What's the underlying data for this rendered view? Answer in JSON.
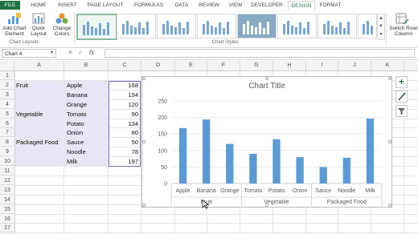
{
  "ribbon": {
    "tabs": [
      "FILE",
      "HOME",
      "INSERT",
      "PAGE LAYOUT",
      "FORMULAS",
      "DATA",
      "REVIEW",
      "VIEW",
      "DEVELOPER",
      "DESIGN",
      "FORMAT"
    ],
    "active_tab": "DESIGN",
    "add_chart_element": "Add Chart Element",
    "quick_layout": "Quick Layout",
    "change_colors": "Change Colors",
    "chart_layouts_group": "Chart Layouts",
    "chart_styles_group": "Chart Styles",
    "switch_row_column": "Switch Row/ Column"
  },
  "formula_bar": {
    "name_box": "Chart 4",
    "fx": "fx"
  },
  "columns": [
    "A",
    "B",
    "C",
    "D",
    "E",
    "F",
    "G",
    "H",
    "I",
    "J",
    "K"
  ],
  "rows": [
    "1",
    "2",
    "3",
    "4",
    "5",
    "6",
    "7",
    "8",
    "9",
    "10",
    "11",
    "12",
    "13",
    "14",
    "15",
    "16",
    "17"
  ],
  "table": [
    {
      "group": "Fruit",
      "item": "Apple",
      "value": "168"
    },
    {
      "group": "",
      "item": "Banana",
      "value": "194"
    },
    {
      "group": "",
      "item": "Orange",
      "value": "120"
    },
    {
      "group": "Vegetable",
      "item": "Tomato",
      "value": "90"
    },
    {
      "group": "",
      "item": "Potato",
      "value": "134"
    },
    {
      "group": "",
      "item": "Onion",
      "value": "80"
    },
    {
      "group": "Packaged Food",
      "item": "Sauce",
      "value": "50"
    },
    {
      "group": "",
      "item": "Noodle",
      "value": "78"
    },
    {
      "group": "",
      "item": "Milk",
      "value": "197"
    }
  ],
  "colors": {
    "bar": "#5b9bd5",
    "excel_green": "#217346",
    "table_fill": "#e8e6f4"
  },
  "chart_data": {
    "type": "bar",
    "title": "Chart Title",
    "categories": [
      "Apple",
      "Banana",
      "Orange",
      "Tomato",
      "Potato",
      "Onion",
      "Sauce",
      "Noodle",
      "Milk"
    ],
    "groups": [
      {
        "name": "Fruit",
        "count": 3
      },
      {
        "name": "Vegetable",
        "count": 3
      },
      {
        "name": "Packaged Food",
        "count": 3
      }
    ],
    "values": [
      168,
      194,
      120,
      90,
      134,
      80,
      50,
      78,
      197
    ],
    "yticks": [
      "0",
      "50",
      "100",
      "150",
      "200",
      "250"
    ],
    "ylim": [
      0,
      250
    ],
    "grid": true,
    "legend": "none"
  }
}
